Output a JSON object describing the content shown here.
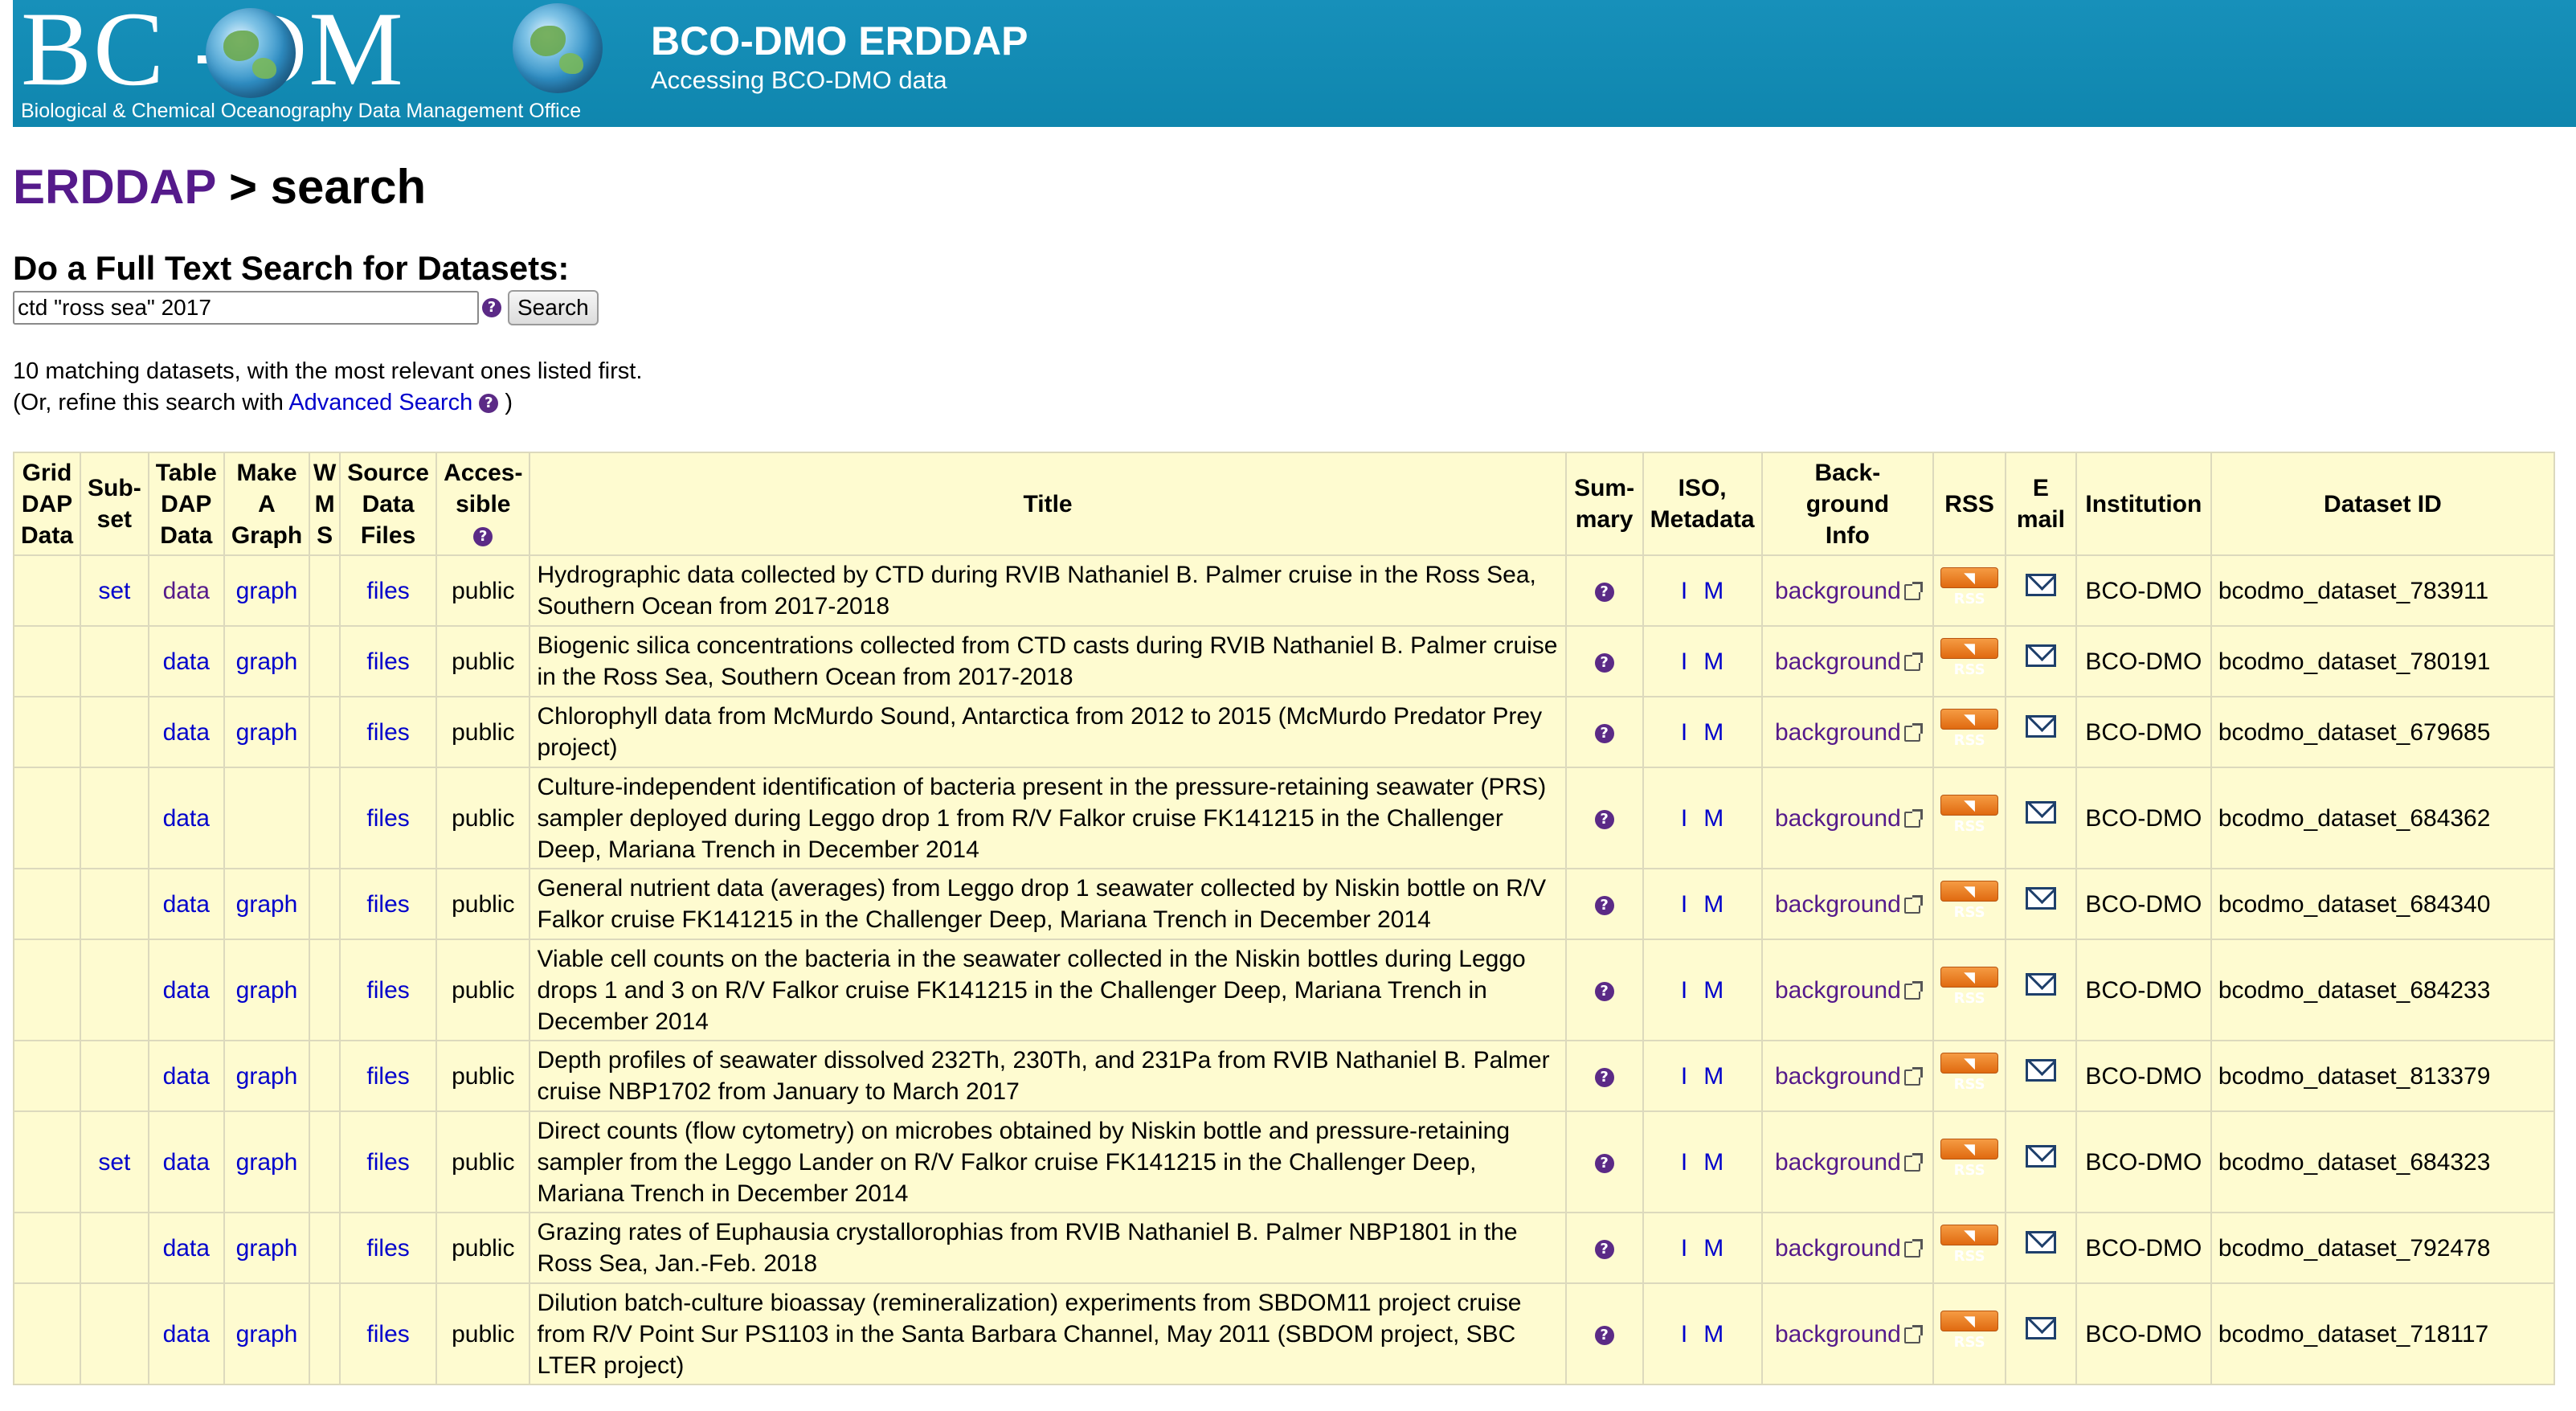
{
  "header": {
    "logo_text": "BC -DM",
    "logo_subtitle": "Biological & Chemical Oceanography Data Management Office",
    "title": "BCO-DMO ERDDAP",
    "subtitle": "Accessing BCO-DMO data"
  },
  "breadcrumb": {
    "root": "ERDDAP",
    "separator": ">",
    "current": "search"
  },
  "search": {
    "heading": "Do a Full Text Search for Datasets:",
    "query": "ctd \"ross sea\" 2017",
    "button": "Search",
    "help_icon": "question-icon"
  },
  "results_summary": {
    "line1": "10 matching datasets, with the most relevant ones listed first.",
    "line2_prefix": "(Or, refine this search with",
    "advanced_link": "Advanced Search",
    "line2_suffix": ")"
  },
  "table": {
    "headers": {
      "griddap": [
        "Grid",
        "DAP",
        "Data"
      ],
      "subset": [
        "Sub-",
        "set"
      ],
      "tabledap": [
        "Table",
        "DAP",
        "Data"
      ],
      "graph": [
        "Make",
        "A",
        "Graph"
      ],
      "wms": [
        "W",
        "M",
        "S"
      ],
      "files": [
        "Source",
        "Data",
        "Files"
      ],
      "accessible": [
        "Acces-",
        "sible"
      ],
      "title": "Title",
      "summary": [
        "Sum-",
        "mary"
      ],
      "iso": [
        "ISO,",
        "Metadata"
      ],
      "background": [
        "Back-",
        "ground",
        "Info"
      ],
      "rss": "RSS",
      "email": [
        "E",
        "mail"
      ],
      "institution": "Institution",
      "dataset_id": "Dataset ID"
    },
    "link_labels": {
      "set": "set",
      "data": "data",
      "graph": "graph",
      "files": "files",
      "public": "public",
      "iso": "I",
      "metadata": "M",
      "background": "background",
      "rss": "RSS"
    },
    "rows": [
      {
        "title": "Hydrographic data collected by CTD during RVIB Nathaniel B. Palmer cruise in the Ross Sea, Southern Ocean from 2017-2018",
        "subset": "set",
        "graph": "graph",
        "institution": "BCO-DMO",
        "dataset_id": "bcodmo_dataset_783911"
      },
      {
        "title": "Biogenic silica concentrations collected from CTD casts during RVIB Nathaniel B. Palmer cruise in the Ross Sea, Southern Ocean from 2017-2018",
        "subset": "",
        "graph": "graph",
        "institution": "BCO-DMO",
        "dataset_id": "bcodmo_dataset_780191"
      },
      {
        "title": "Chlorophyll data from McMurdo Sound, Antarctica from 2012 to 2015 (McMurdo Predator Prey project)",
        "subset": "",
        "graph": "graph",
        "institution": "BCO-DMO",
        "dataset_id": "bcodmo_dataset_679685"
      },
      {
        "title": "Culture-independent identification of bacteria present in the pressure-retaining seawater (PRS) sampler deployed during Leggo drop 1 from R/V Falkor cruise FK141215 in the Challenger Deep, Mariana Trench in December 2014",
        "subset": "",
        "graph": "",
        "institution": "BCO-DMO",
        "dataset_id": "bcodmo_dataset_684362"
      },
      {
        "title": "General nutrient data (averages) from Leggo drop 1 seawater collected by Niskin bottle on R/V Falkor cruise FK141215 in the Challenger Deep, Mariana Trench in December 2014",
        "subset": "",
        "graph": "graph",
        "institution": "BCO-DMO",
        "dataset_id": "bcodmo_dataset_684340"
      },
      {
        "title": "Viable cell counts on the bacteria in the seawater collected in the Niskin bottles during Leggo drops 1 and 3 on R/V Falkor cruise FK141215 in the Challenger Deep, Mariana Trench in December 2014",
        "subset": "",
        "graph": "graph",
        "institution": "BCO-DMO",
        "dataset_id": "bcodmo_dataset_684233"
      },
      {
        "title": "Depth profiles of seawater dissolved 232Th, 230Th, and 231Pa from RVIB Nathaniel B. Palmer cruise NBP1702 from January to March 2017",
        "subset": "",
        "graph": "graph",
        "institution": "BCO-DMO",
        "dataset_id": "bcodmo_dataset_813379"
      },
      {
        "title": "Direct counts (flow cytometry) on microbes obtained by Niskin bottle and pressure-retaining sampler from the Leggo Lander on R/V Falkor cruise FK141215 in the Challenger Deep, Mariana Trench in December 2014",
        "subset": "set",
        "graph": "graph",
        "institution": "BCO-DMO",
        "dataset_id": "bcodmo_dataset_684323"
      },
      {
        "title": "Grazing rates of Euphausia crystallorophias from RVIB Nathaniel B. Palmer NBP1801 in the Ross Sea, Jan.-Feb. 2018",
        "subset": "",
        "graph": "graph",
        "institution": "BCO-DMO",
        "dataset_id": "bcodmo_dataset_792478"
      },
      {
        "title": "Dilution batch-culture bioassay (remineralization) experiments from SBDOM11 project cruise from R/V Point Sur PS1103 in the Santa Barbara Channel, May 2011 (SBDOM project, SBC LTER project)",
        "subset": "",
        "graph": "graph",
        "institution": "BCO-DMO",
        "dataset_id": "bcodmo_dataset_718117"
      }
    ]
  },
  "colors": {
    "banner": "#128cb4",
    "table_background": "#fefbd0",
    "link": "#0000cc",
    "visited_link": "#551a8b"
  }
}
